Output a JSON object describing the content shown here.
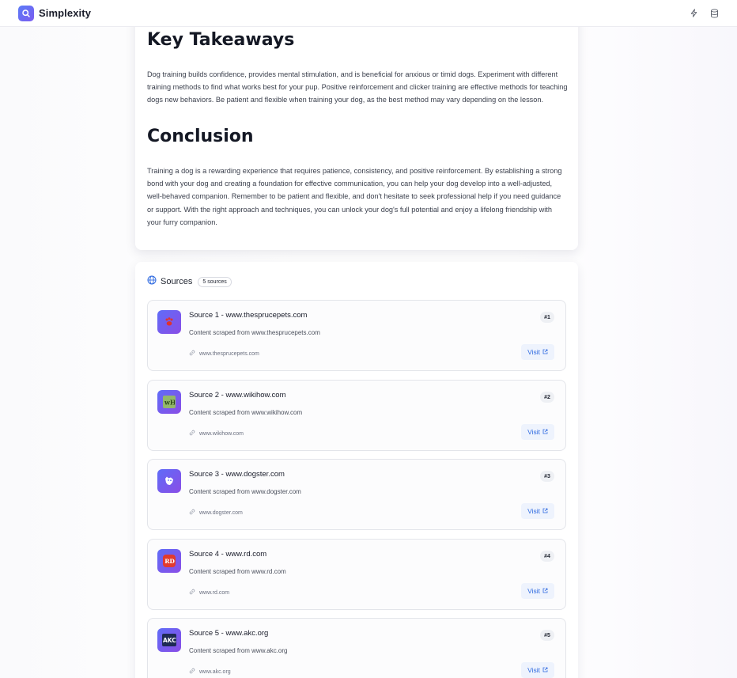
{
  "app": {
    "name": "Simplexity",
    "header_icons": [
      "sparkle-icon",
      "database-icon"
    ]
  },
  "article": {
    "takeaways_heading": "Key Takeaways",
    "takeaways_text": "Dog training builds confidence, provides mental stimulation, and is beneficial for anxious or timid dogs. Experiment with different training methods to find what works best for your pup. Positive reinforcement and clicker training are effective methods for teaching dogs new behaviors. Be patient and flexible when training your dog, as the best method may vary depending on the lesson.",
    "conclusion_heading": "Conclusion",
    "conclusion_text": "Training a dog is a rewarding experience that requires patience, consistency, and positive reinforcement. By establishing a strong bond with your dog and creating a foundation for effective communication, you can help your dog develop into a well-adjusted, well-behaved companion. Remember to be patient and flexible, and don't hesitate to seek professional help if you need guidance or support. With the right approach and techniques, you can unlock your dog's full potential and enjoy a lifelong friendship with your furry companion."
  },
  "sources": {
    "title": "Sources",
    "count_label": "5 sources",
    "items": [
      {
        "title": "Source 1 - www.thesprucepets.com",
        "desc": "Content scraped from www.thesprucepets.com",
        "url": "www.thesprucepets.com",
        "num": "#1",
        "visit": "Visit",
        "favicon": "paw-icon"
      },
      {
        "title": "Source 2 - www.wikihow.com",
        "desc": "Content scraped from www.wikihow.com",
        "url": "www.wikihow.com",
        "num": "#2",
        "visit": "Visit",
        "favicon": "wikihow-icon"
      },
      {
        "title": "Source 3 - www.dogster.com",
        "desc": "Content scraped from www.dogster.com",
        "url": "www.dogster.com",
        "num": "#3",
        "visit": "Visit",
        "favicon": "dogster-icon"
      },
      {
        "title": "Source 4 - www.rd.com",
        "desc": "Content scraped from www.rd.com",
        "url": "www.rd.com",
        "num": "#4",
        "visit": "Visit",
        "favicon": "rd-icon"
      },
      {
        "title": "Source 5 - www.akc.org",
        "desc": "Content scraped from www.akc.org",
        "url": "www.akc.org",
        "num": "#5",
        "visit": "Visit",
        "favicon": "akc-icon"
      }
    ]
  },
  "colors": {
    "accent": "#2f6ae0",
    "brand_gradient_start": "#5b7cf7",
    "brand_gradient_end": "#7b5cf0"
  }
}
